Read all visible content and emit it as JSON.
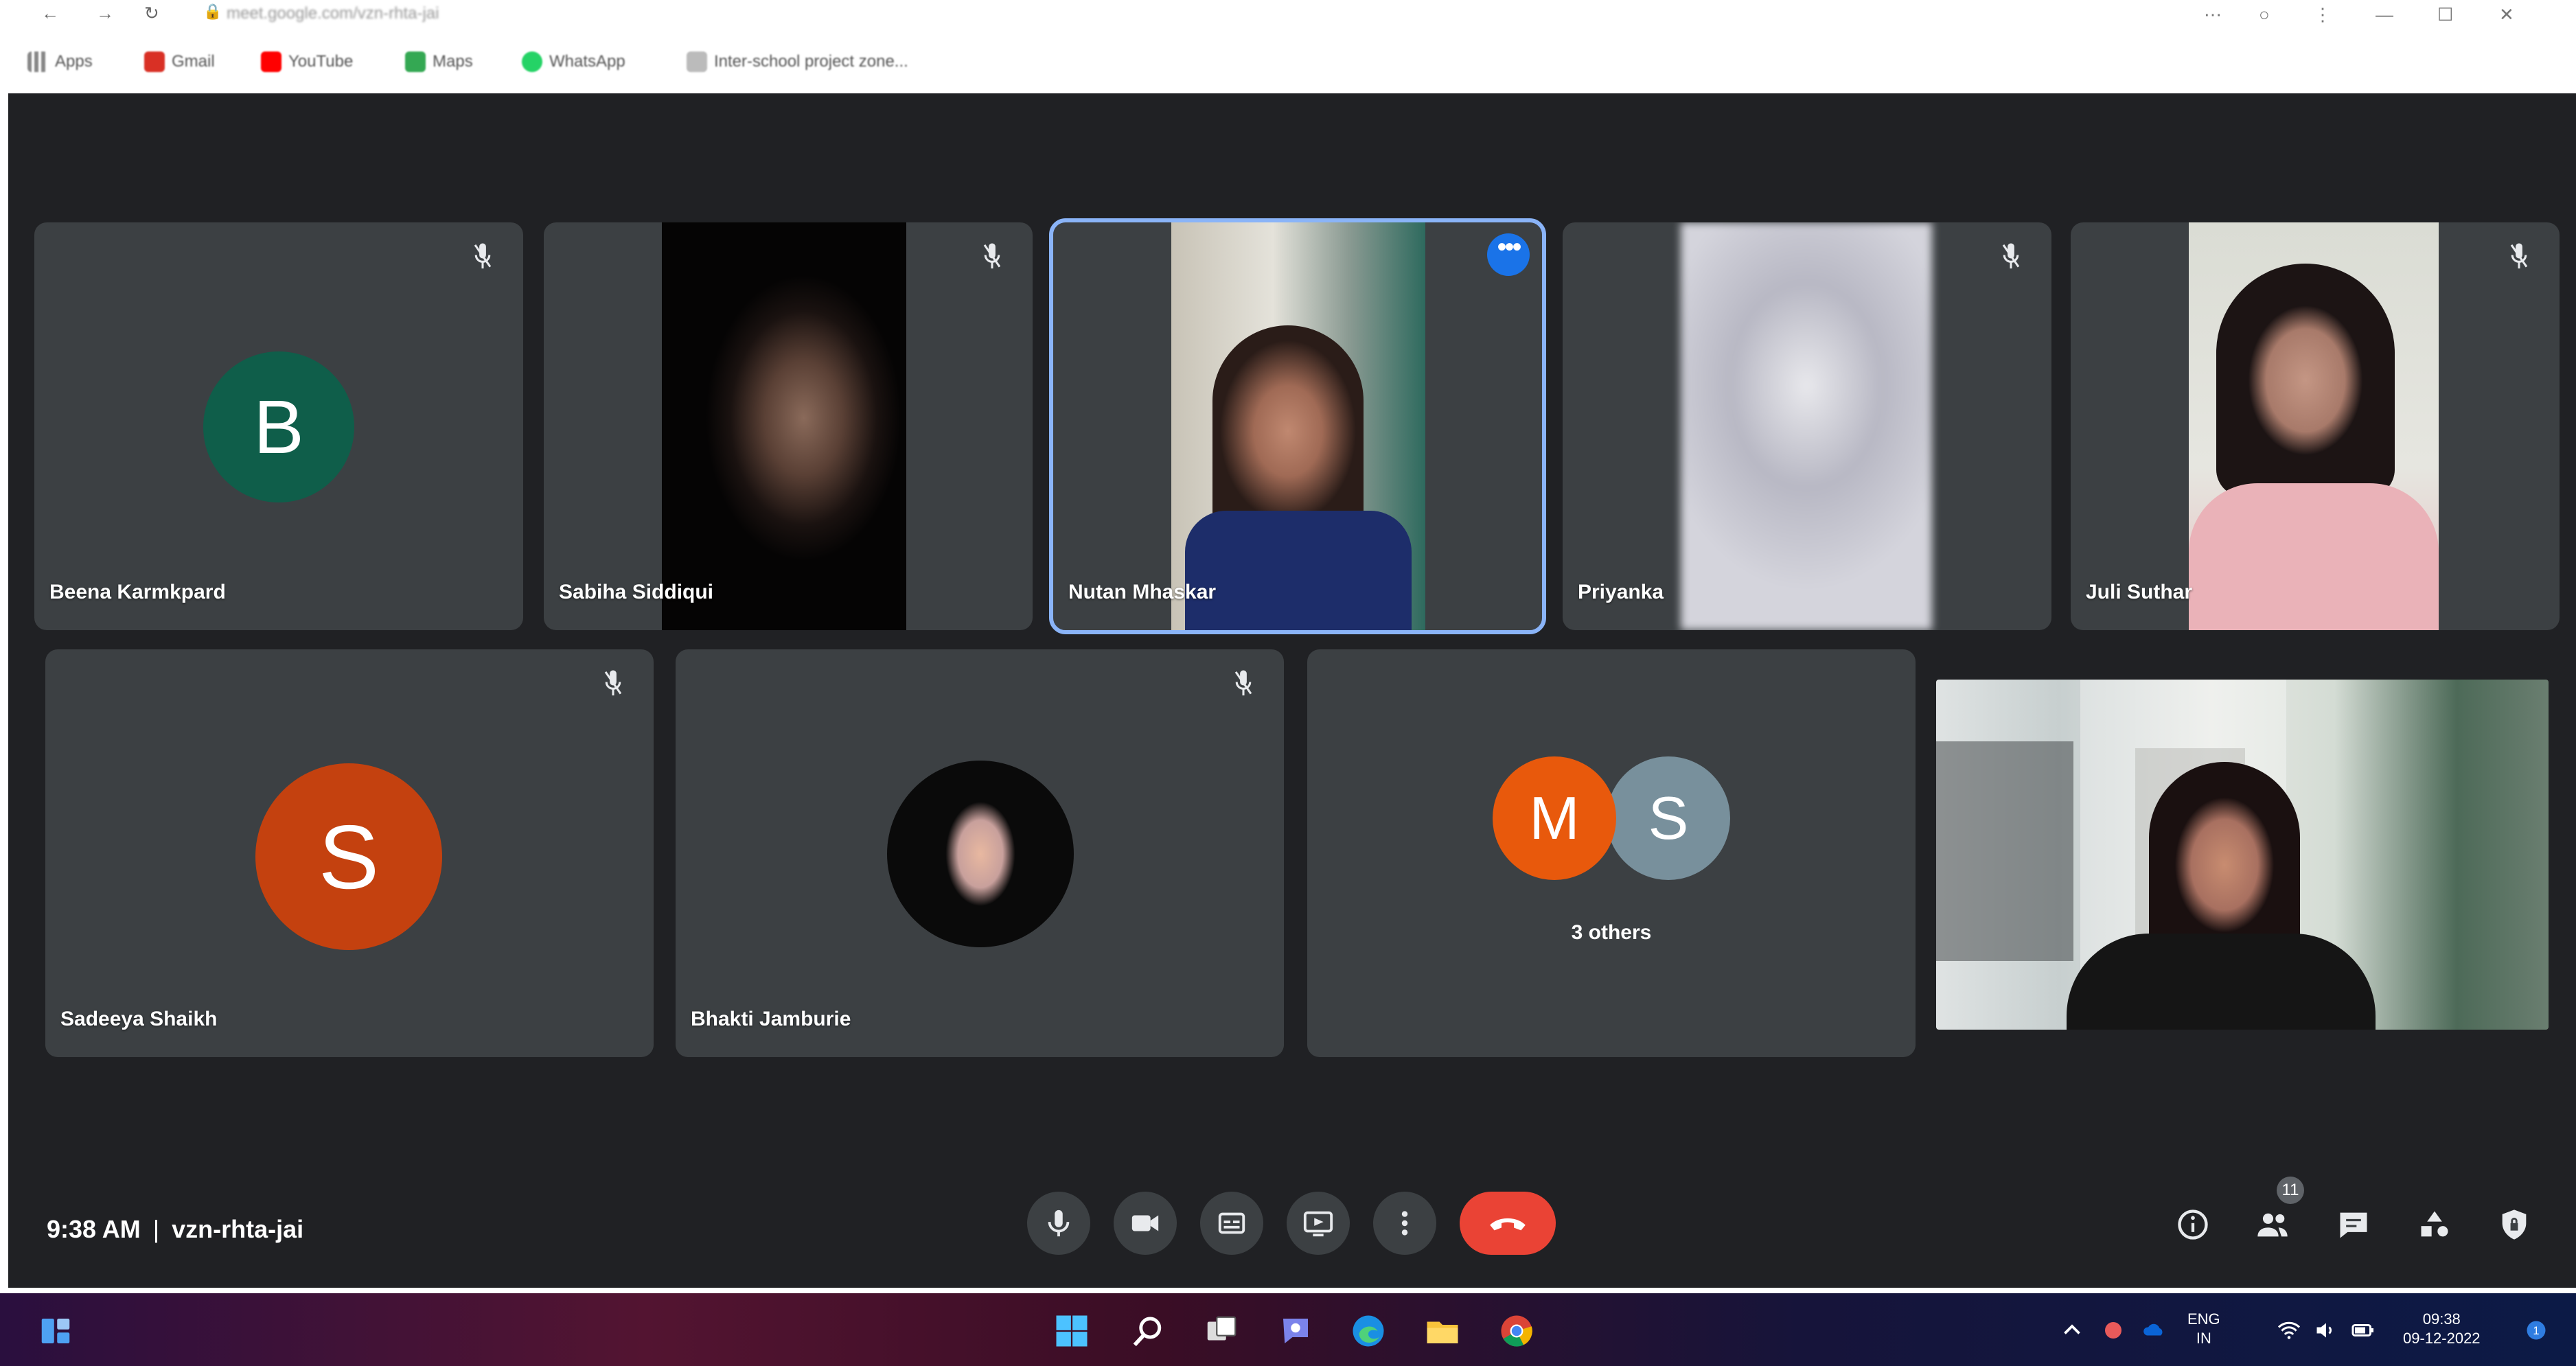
{
  "browser": {
    "url": "meet.google.com/vzn-rhta-jai",
    "bookmarks": [
      {
        "label": "Apps",
        "icon": "apps-grid-icon",
        "color": "#5f6368"
      },
      {
        "label": "Gmail",
        "icon": "gmail-icon",
        "color": "#d93025"
      },
      {
        "label": "YouTube",
        "icon": "youtube-icon",
        "color": "#ff0000"
      },
      {
        "label": "Maps",
        "icon": "maps-icon",
        "color": "#34a853"
      },
      {
        "label": "WhatsApp",
        "icon": "whatsapp-icon",
        "color": "#25d366"
      },
      {
        "label": "Inter-school project zone...",
        "icon": "page-icon",
        "color": "#5f6368"
      }
    ]
  },
  "meet": {
    "participants": [
      {
        "name": "Beena Karmkpard",
        "avatar_letter": "B",
        "avatar_color": "#0f5e4a",
        "mic": "muted"
      },
      {
        "name": "Sabiha Siddiqui",
        "mic": "muted"
      },
      {
        "name": "Nutan Mhaskar",
        "active": true
      },
      {
        "name": "Priyanka",
        "mic": "muted"
      },
      {
        "name": "Juli Suthar",
        "mic": "muted"
      },
      {
        "name": "Sadeeya Shaikh",
        "avatar_letter": "S",
        "avatar_color": "#c4410f",
        "mic": "muted"
      },
      {
        "name": "Bhakti Jamburie",
        "mic": "muted"
      },
      {
        "label": "3 others",
        "avatar_letters": [
          "M",
          "S"
        ],
        "avatar_colors": [
          "#e8590c",
          "#78909c"
        ]
      }
    ],
    "time": "9:38 AM",
    "separator": "|",
    "meeting_code": "vzn-rhta-jai",
    "participants_count": "11",
    "hangup_color": "#ea4335",
    "accent_color": "#8ab4f8"
  },
  "taskbar": {
    "language": [
      "ENG",
      "IN"
    ],
    "clock": [
      "09:38",
      "09-12-2022"
    ]
  }
}
